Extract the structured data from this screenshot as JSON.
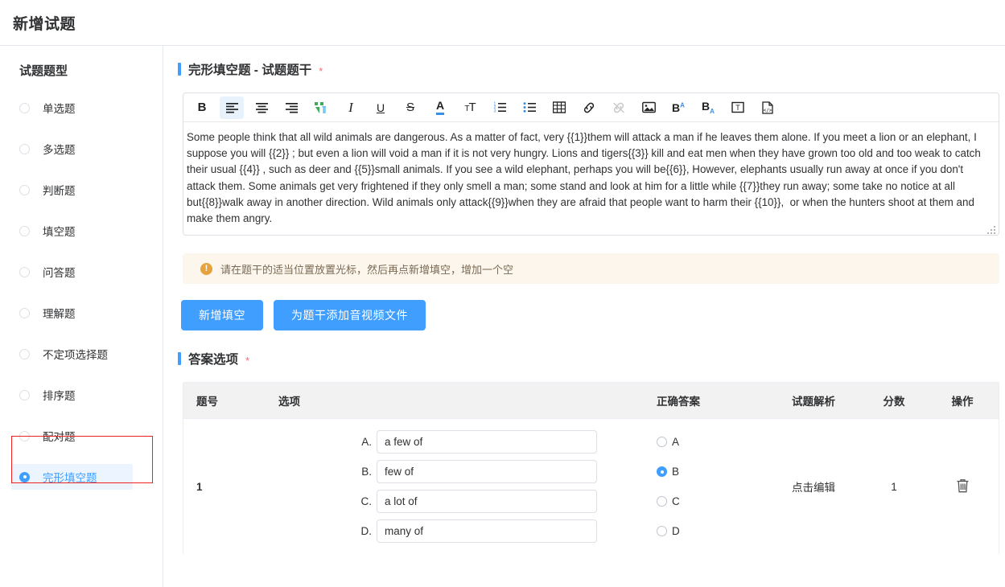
{
  "header": {
    "title": "新增试题"
  },
  "sidebar": {
    "title": "试题题型",
    "items": [
      {
        "label": "单选题",
        "selected": false
      },
      {
        "label": "多选题",
        "selected": false
      },
      {
        "label": "判断题",
        "selected": false
      },
      {
        "label": "填空题",
        "selected": false
      },
      {
        "label": "问答题",
        "selected": false
      },
      {
        "label": "理解题",
        "selected": false
      },
      {
        "label": "不定项选择题",
        "selected": false
      },
      {
        "label": "排序题",
        "selected": false
      },
      {
        "label": "配对题",
        "selected": false
      },
      {
        "label": "完形填空题",
        "selected": true
      }
    ]
  },
  "stem_section": {
    "title": "完形填空题 - 试题题干",
    "required_mark": "*",
    "toolbar": [
      {
        "name": "bold-icon",
        "glyph": "B",
        "active": false,
        "disabled": false
      },
      {
        "name": "align-left-icon",
        "glyph": "",
        "active": true,
        "disabled": false
      },
      {
        "name": "align-center-icon",
        "glyph": "",
        "active": false,
        "disabled": false
      },
      {
        "name": "align-right-icon",
        "glyph": "",
        "active": false,
        "disabled": false
      },
      {
        "name": "paragraph-mark-icon",
        "glyph": "",
        "active": false,
        "disabled": false
      },
      {
        "name": "italic-icon",
        "glyph": "I",
        "active": false,
        "disabled": false
      },
      {
        "name": "underline-icon",
        "glyph": "U",
        "active": false,
        "disabled": false
      },
      {
        "name": "strikethrough-icon",
        "glyph": "S",
        "active": false,
        "disabled": false
      },
      {
        "name": "font-color-icon",
        "glyph": "A",
        "active": false,
        "disabled": false
      },
      {
        "name": "font-size-icon",
        "glyph": "тT",
        "active": false,
        "disabled": false
      },
      {
        "name": "ordered-list-icon",
        "glyph": "",
        "active": false,
        "disabled": false
      },
      {
        "name": "unordered-list-icon",
        "glyph": "",
        "active": false,
        "disabled": false
      },
      {
        "name": "table-icon",
        "glyph": "",
        "active": false,
        "disabled": false
      },
      {
        "name": "link-icon",
        "glyph": "",
        "active": false,
        "disabled": false
      },
      {
        "name": "unlink-icon",
        "glyph": "",
        "active": false,
        "disabled": true
      },
      {
        "name": "image-icon",
        "glyph": "",
        "active": false,
        "disabled": false
      },
      {
        "name": "superscript-icon",
        "glyph": "",
        "active": false,
        "disabled": false
      },
      {
        "name": "subscript-icon",
        "glyph": "",
        "active": false,
        "disabled": false
      },
      {
        "name": "text-box-icon",
        "glyph": "",
        "active": false,
        "disabled": false
      },
      {
        "name": "source-code-icon",
        "glyph": "",
        "active": false,
        "disabled": false
      }
    ],
    "passage": "Some people think that all wild animals are dangerous. As a matter of fact, very {{1}}them will attack a man if he leaves them alone. If you meet a lion or an elephant, I suppose you will {{2}} ; but even a lion will void a man if it is not very hungry. Lions and tigers{{3}} kill and eat men when they have grown too old and too weak to catch their usual {{4}} , such as deer and {{5}}small animals. If you see a wild elephant, perhaps you will be{{6}}, However, elephants usually run away at once if you don't attack them. Some animals get very frightened if they only smell a man; some stand and look at him for a little while {{7}}they run away; some take no notice at all but{{8}}walk away in another direction. Wild animals only attack{{9}}when they are afraid that people want to harm their {{10}},  or when the hunters shoot at them and make them angry."
  },
  "alert": {
    "icon": "warning-icon",
    "glyph": "!",
    "text": "请在题干的适当位置放置光标，然后再点新增填空，增加一个空"
  },
  "buttons": {
    "add_blank": "新增填空",
    "add_media": "为题干添加音视频文件"
  },
  "answer_section": {
    "title": "答案选项",
    "required_mark": "*",
    "columns": [
      "题号",
      "选项",
      "正确答案",
      "试题解析",
      "分数",
      "操作"
    ],
    "rows": [
      {
        "no": "1",
        "options": [
          {
            "letter": "A.",
            "value": "a few of"
          },
          {
            "letter": "B.",
            "value": "few of"
          },
          {
            "letter": "C.",
            "value": "a lot of"
          },
          {
            "letter": "D.",
            "value": "many of"
          }
        ],
        "answers": [
          {
            "label": "A",
            "checked": false
          },
          {
            "label": "B",
            "checked": true
          },
          {
            "label": "C",
            "checked": false
          },
          {
            "label": "D",
            "checked": false
          }
        ],
        "explanation": "点击编辑",
        "score": "1",
        "action_icon": "trash-icon"
      }
    ]
  },
  "colors": {
    "accent": "#409eff",
    "required": "#f56c6c",
    "alert_bg": "#fdf6ec",
    "alert_icon": "#e6a23c",
    "selection_outline": "#ee2222",
    "selection_bg": "#ecf5ff"
  }
}
